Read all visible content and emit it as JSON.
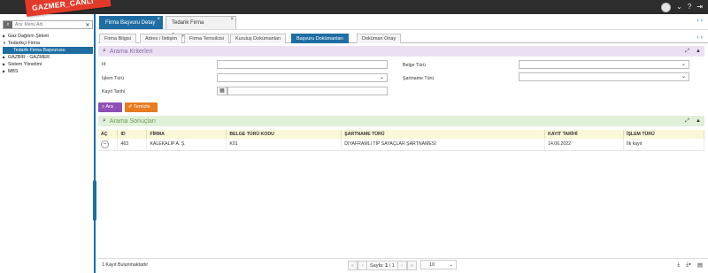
{
  "brand": {
    "label": "GAZMER_CANLI"
  },
  "topbar": {
    "icons": [
      "avatar",
      "chevron-down-icon",
      "help-icon",
      "logout-icon"
    ],
    "help_label": "?",
    "logout_label": "⇥"
  },
  "sidebar": {
    "search_placeholder": "Ara: Menü Adı",
    "items": [
      {
        "label": "Gaz Dağıtım Şirketi",
        "level": 0,
        "expanded": false
      },
      {
        "label": "Tedarikçi Firma",
        "level": 0,
        "expanded": true
      },
      {
        "label": "Tedarik Firma Başvurusu",
        "level": 1,
        "active": true
      },
      {
        "label": "GAZBİR - GAZMER",
        "level": 0,
        "expanded": false
      },
      {
        "label": "Sistem Yönetimi",
        "level": 0,
        "expanded": false
      },
      {
        "label": "MBS",
        "level": 0,
        "expanded": false
      }
    ]
  },
  "main_tabs": [
    {
      "label": "Firma Başvuru Detay",
      "active": true
    },
    {
      "label": "Tedarik Firma Başvurusu",
      "active": false
    }
  ],
  "sub_tabs": [
    {
      "label": "Firma Bilgisi"
    },
    {
      "label": "Adres / İletişim"
    },
    {
      "label": "Firma Temsilcisi"
    },
    {
      "label": "Kuruluş Dokümanları"
    },
    {
      "label": "Başvuru Dokümanları",
      "active": true
    },
    {
      "label": "Doküman Onay"
    }
  ],
  "criteria": {
    "title": "Arama Kriterleri",
    "fields": {
      "id_label": "Id",
      "islem_turu_label": "İşlem Türü",
      "kayit_tarihi_label": "Kayıt Tarihi",
      "belge_turu_label": "Belge Türü",
      "sartname_turu_label": "Şartname Türü"
    }
  },
  "buttons": {
    "ara": "Ara",
    "temizle": "Temizle"
  },
  "results": {
    "title": "Arama Sonuçları",
    "columns": [
      "AÇ",
      "ID",
      "FİRMA",
      "BELGE TÜRÜ KODU",
      "ŞARTNAME TÜRÜ",
      "KAYIT TARİHİ",
      "İŞLEM TÜRÜ"
    ],
    "rows": [
      {
        "id": "463",
        "firma": "KALEKALIP A. Ş.",
        "belge_turu_kodu": "K01",
        "sartname_turu": "DİYAFRAMLI TİP SAYAÇLAR ŞARTNAMESİ",
        "kayit_tarihi": "14.06.2022",
        "islem_turu": "İlk kayıt"
      }
    ]
  },
  "footer": {
    "count_text": "1 Kayıt Bulunmaktadır",
    "page_label": "Sayfa:",
    "page_current": "1",
    "page_sep": "/",
    "page_total": "1",
    "page_size": "10"
  },
  "colors": {
    "accent": "#1f6ea3",
    "criteria_bg": "#ebe0f3",
    "results_bg": "#e1f0d9",
    "ara_btn": "#8f4fb5",
    "temizle_btn": "#e77c22",
    "brand": "#e23a2a"
  }
}
